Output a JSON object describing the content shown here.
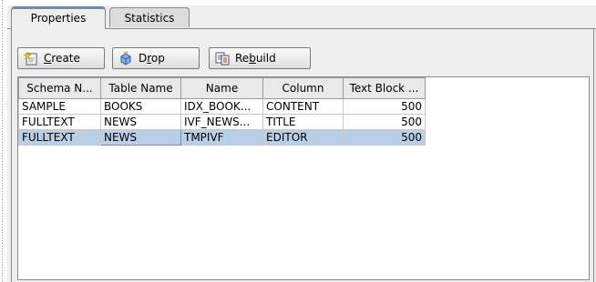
{
  "tabs": [
    {
      "label": "Properties",
      "active": true
    },
    {
      "label": "Statistics",
      "active": false
    }
  ],
  "toolbar": {
    "create": {
      "label": "Create",
      "icon": "create-icon"
    },
    "drop": {
      "label": "Drop",
      "icon": "drop-icon"
    },
    "rebuild": {
      "label": "Rebuild",
      "icon": "rebuild-icon"
    }
  },
  "table": {
    "columns": [
      "Schema N...",
      "Table Name",
      "Name",
      "Column",
      "Text Block ..."
    ],
    "rows": [
      [
        "SAMPLE",
        "BOOKS",
        "IDX_BOOK...",
        "CONTENT",
        "500"
      ],
      [
        "FULLTEXT",
        "NEWS",
        "IVF_NEWS...",
        "TITLE",
        "500"
      ],
      [
        "FULLTEXT",
        "NEWS",
        "TMPIVF",
        "EDITOR",
        "500"
      ]
    ],
    "selected_row": 2
  },
  "colors": {
    "selection": "#b8cfe5",
    "tab_accent": "#6a8cb8"
  }
}
